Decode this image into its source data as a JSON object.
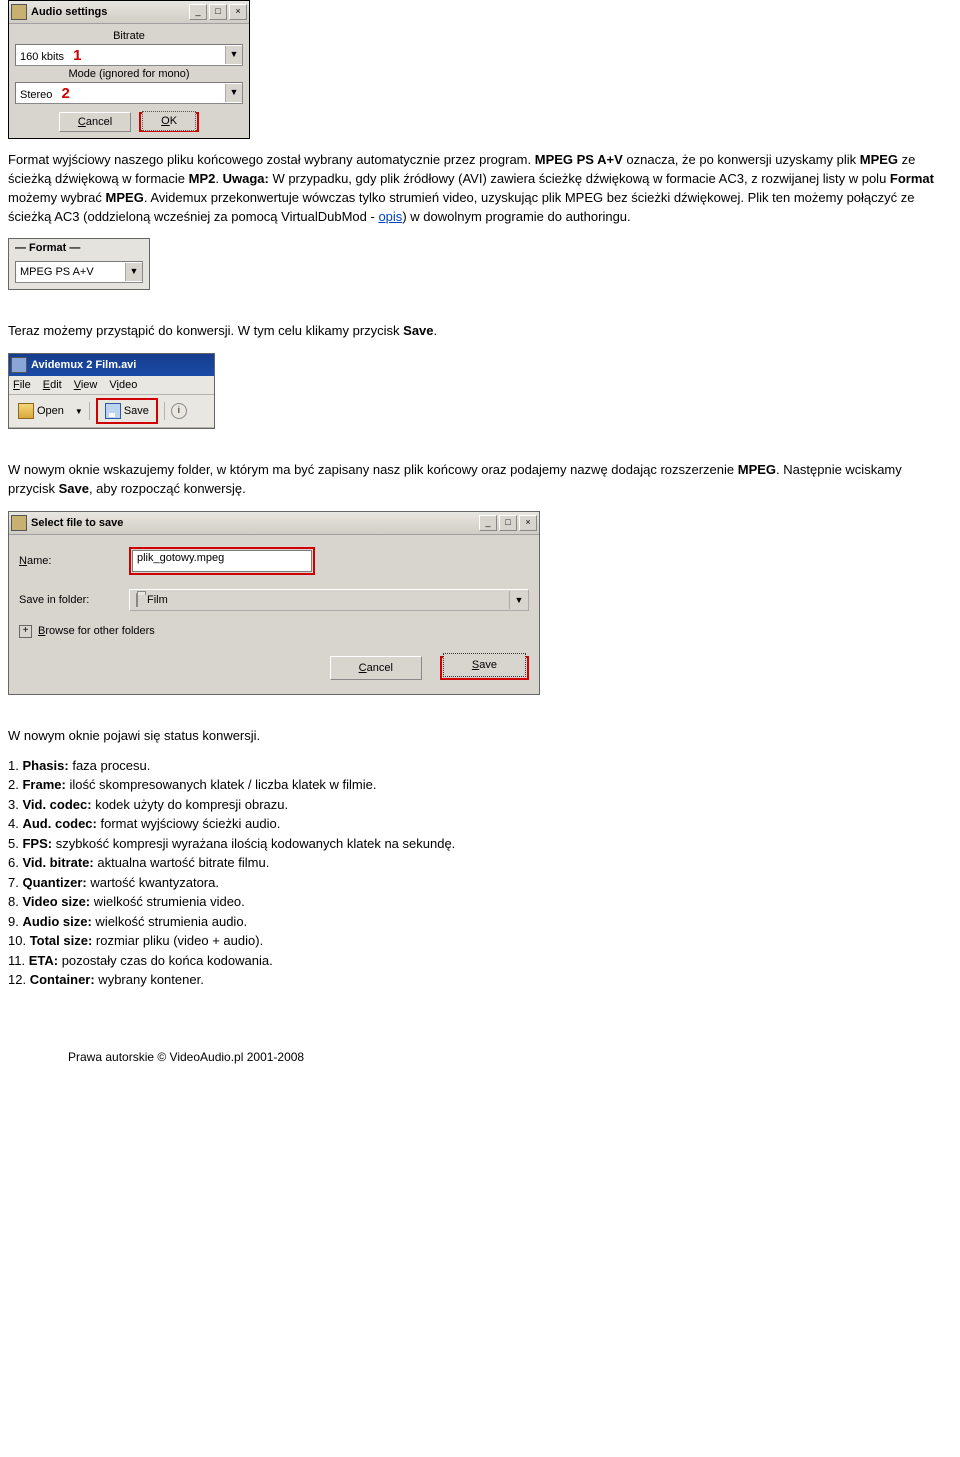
{
  "audio_dialog": {
    "title": "Audio settings",
    "bitrate_label": "Bitrate",
    "bitrate_value": "160 kbits",
    "annot1": "1",
    "mode_label": "Mode (ignored for mono)",
    "mode_value": "Stereo",
    "annot2": "2",
    "cancel": "Cancel",
    "ok": "OK"
  },
  "p1": {
    "t1": "Format wyjściowy naszego pliku końcowego został wybrany automatycznie przez program. ",
    "b1": "MPEG PS A+V",
    "t2": " oznacza, że po konwersji uzyskamy plik ",
    "b2": "MPEG",
    "t3": " ze ścieżką dźwiękową w formacie ",
    "b3": "MP2",
    "t4": ". ",
    "b4": "Uwaga:",
    "t5": " W przypadku, gdy plik źródłowy (AVI) zawiera ścieżkę dźwiękową w formacie AC3, z rozwijanej listy w polu ",
    "b5": "Format",
    "t6": " możemy wybrać ",
    "b6": "MPEG",
    "t7": ". Avidemux przekonwertuje wówczas tylko strumień video, uzyskując plik MPEG bez ścieżki dźwiękowej. Plik ten możemy połączyć ze ścieżką AC3 (oddzieloną wcześniej za pomocą VirtualDubMod - ",
    "link": "opis",
    "t8": ") w dowolnym programie do authoringu."
  },
  "format_snippet": {
    "heading": "— Format —",
    "value": "MPEG PS A+V"
  },
  "p2": {
    "t1": "Teraz możemy przystąpić do konwersji. W tym celu klikamy przycisk ",
    "b1": "Save",
    "t2": "."
  },
  "av_toolbar": {
    "title": "Avidemux 2 Film.avi",
    "m_file": "File",
    "m_edit": "Edit",
    "m_view": "View",
    "m_video": "Video",
    "btn_open": "Open",
    "btn_save": "Save"
  },
  "p3": {
    "t1": "W nowym oknie wskazujemy folder, w którym ma być zapisany nasz plik końcowy oraz podajemy nazwę dodając rozszerzenie ",
    "b1": "MPEG",
    "t2": ". Następnie wciskamy przycisk ",
    "b2": "Save",
    "t3": ", aby rozpocząć konwersję."
  },
  "save_dialog": {
    "title": "Select  file to save",
    "name_label": "Name:",
    "name_value": "plik_gotowy.mpeg",
    "folder_label": "Save in folder:",
    "folder_value": "Film",
    "browse": "Browse for other folders",
    "cancel": "Cancel",
    "save": "Save"
  },
  "p4_intro": "W nowym oknie pojawi się status konwersji.",
  "status": [
    {
      "n": "1.",
      "b": "Phasis:",
      "t": " faza procesu."
    },
    {
      "n": "2.",
      "b": "Frame:",
      "t": " ilość skompresowanych klatek / liczba klatek w filmie."
    },
    {
      "n": "3.",
      "b": "Vid. codec:",
      "t": " kodek użyty do kompresji obrazu."
    },
    {
      "n": "4.",
      "b": "Aud. codec:",
      "t": " format wyjściowy ścieżki audio."
    },
    {
      "n": "5.",
      "b": "FPS:",
      "t": " szybkość kompresji wyrażana ilością kodowanych klatek na sekundę."
    },
    {
      "n": "6.",
      "b": "Vid. bitrate:",
      "t": " aktualna wartość bitrate filmu."
    },
    {
      "n": "7.",
      "b": "Quantizer:",
      "t": " wartość kwantyzatora."
    },
    {
      "n": "8.",
      "b": "Video size:",
      "t": " wielkość strumienia video."
    },
    {
      "n": "9.",
      "b": "Audio size:",
      "t": " wielkość strumienia audio."
    },
    {
      "n": "10.",
      "b": "Total size:",
      "t": " rozmiar pliku (video + audio)."
    },
    {
      "n": "11.",
      "b": "ETA:",
      "t": " pozostały czas do końca kodowania."
    },
    {
      "n": "12.",
      "b": "Container:",
      "t": " wybrany kontener."
    }
  ],
  "footer": "Prawa autorskie © VideoAudio.pl 2001-2008"
}
